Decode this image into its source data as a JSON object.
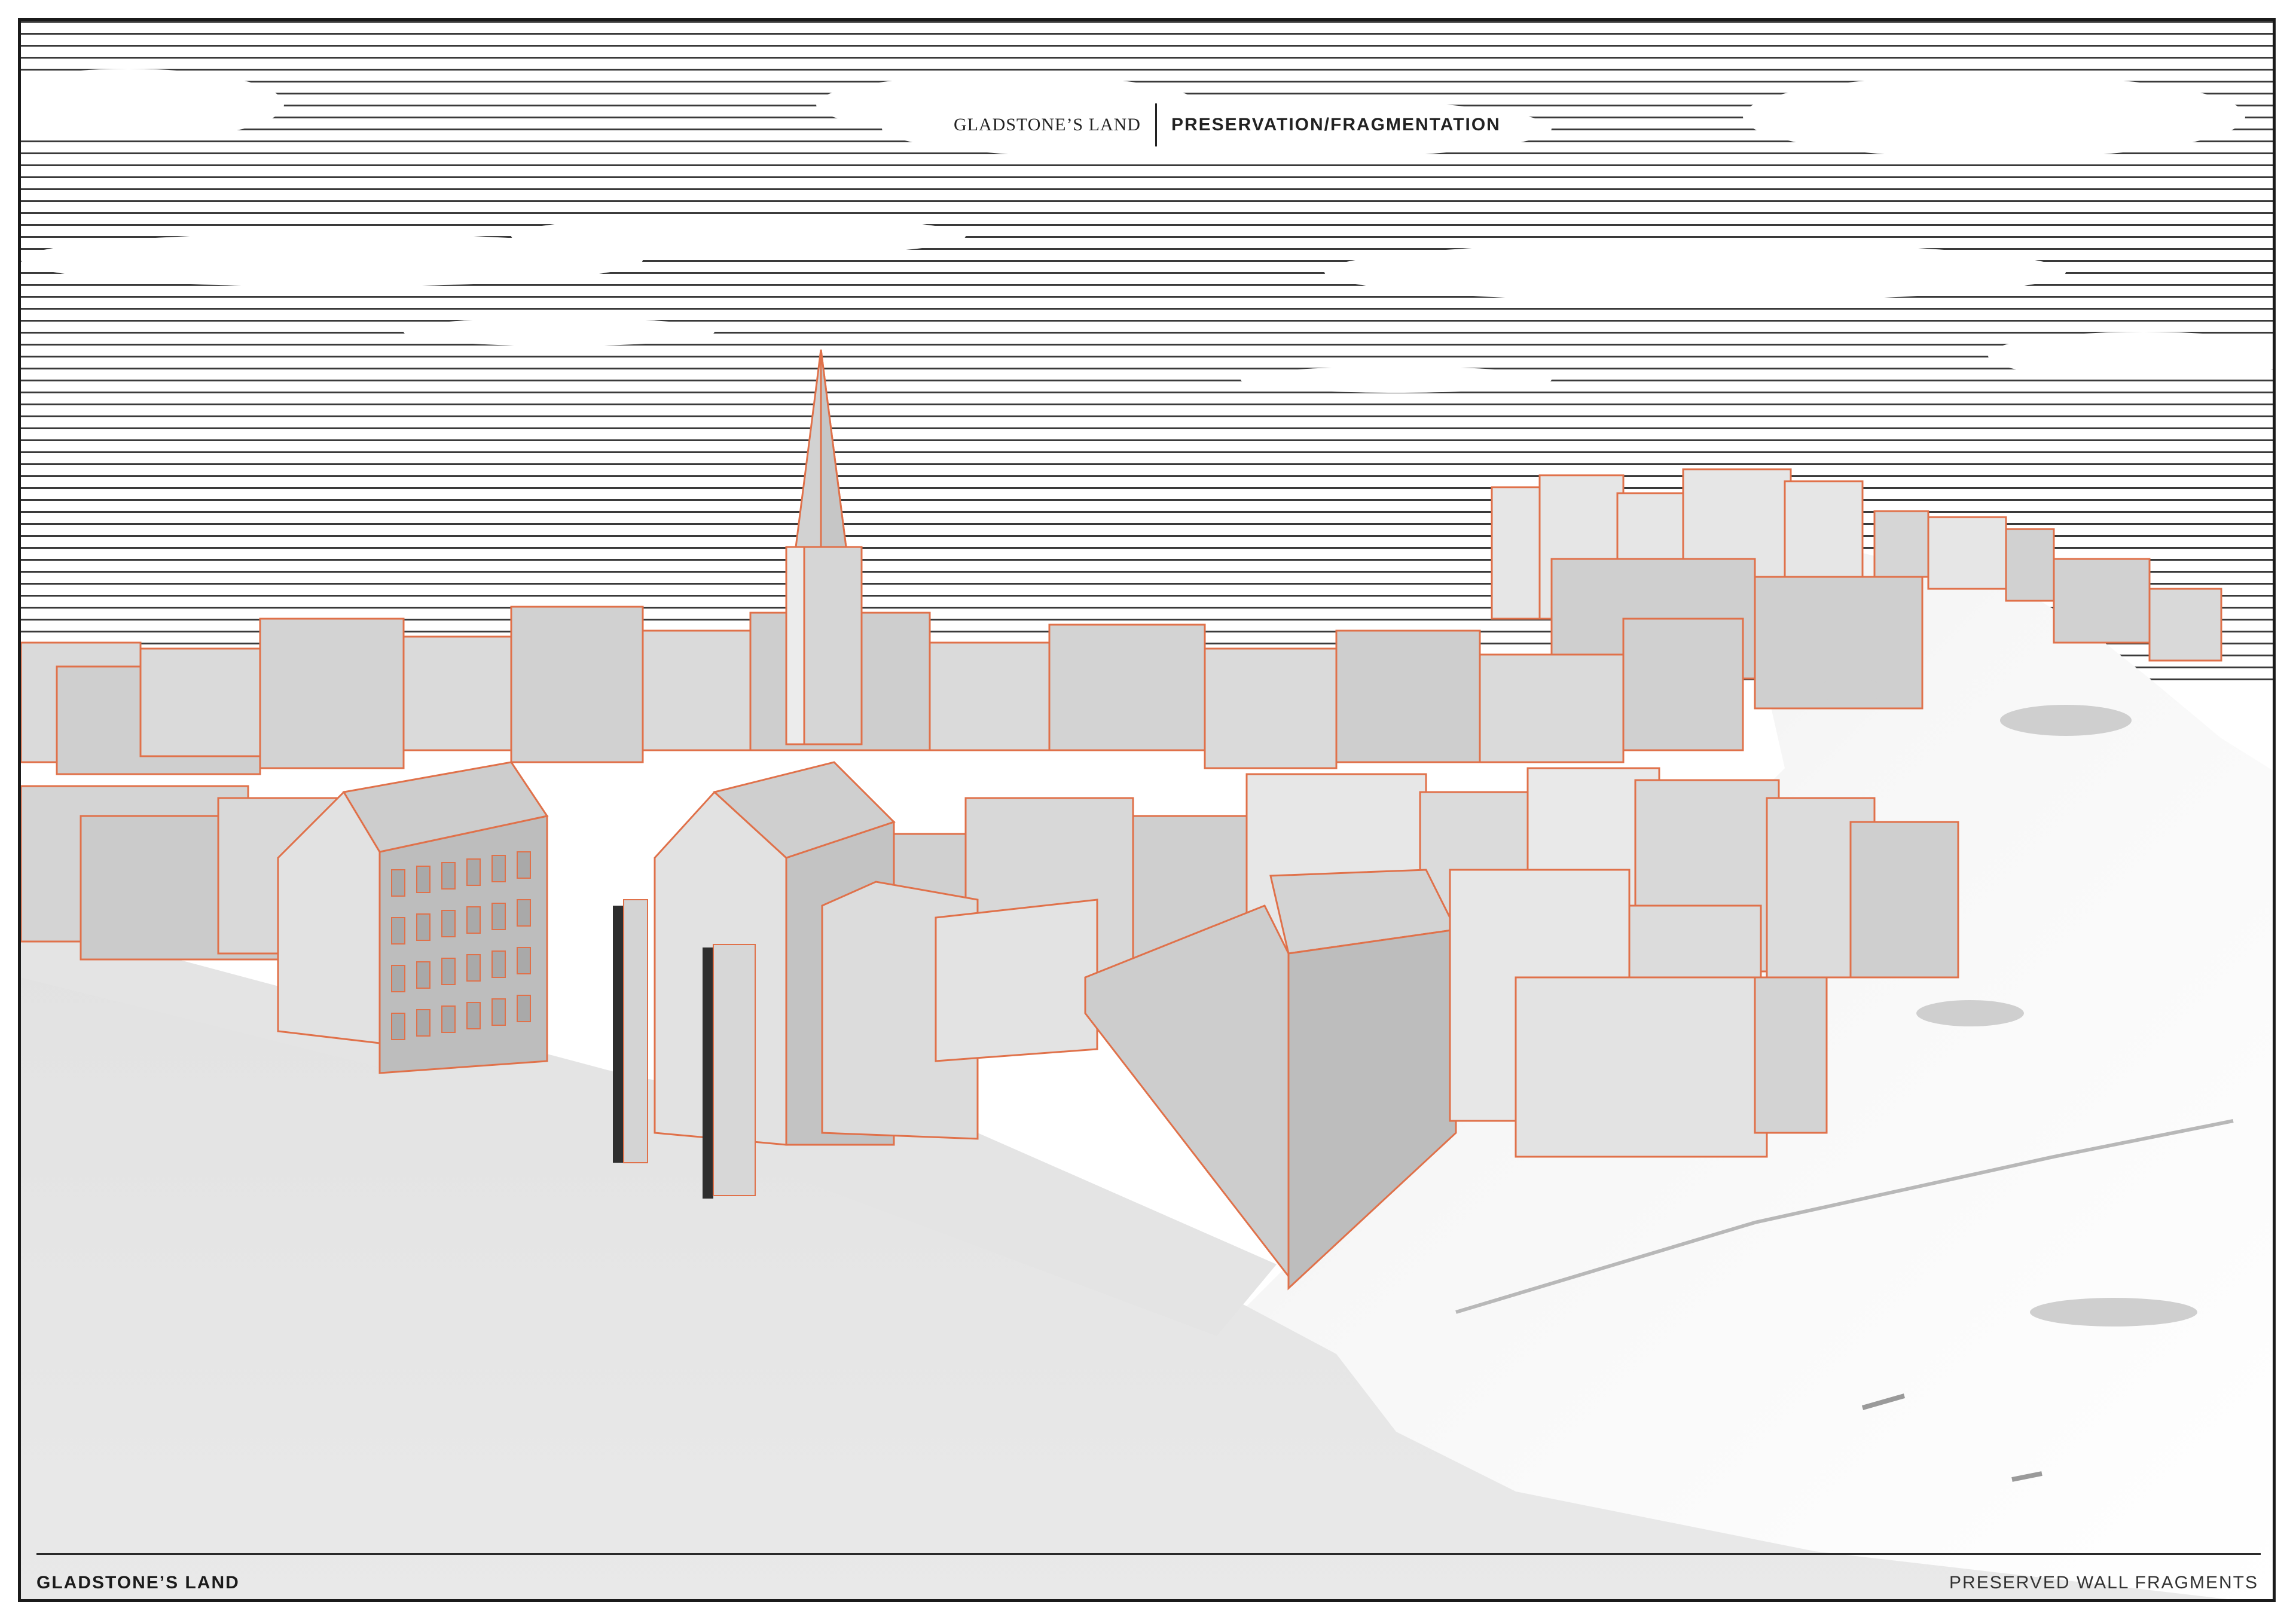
{
  "header": {
    "left_title": "GLADSTONE’S LAND",
    "right_title": "PRESERVATION/FRAGMENTATION"
  },
  "footer": {
    "left_label": "GLADSTONE’S LAND",
    "right_label": "PRESERVED WALL FRAGMENTS"
  },
  "colors": {
    "outline_accent": "#e0714a",
    "building_fill": "#d9d9d9",
    "building_shadow": "#c4c4c4",
    "preserved_wall": "#2e2e2e",
    "sky_hatch": "#3a3a3a",
    "ground": "#e6e6e6",
    "hill": "#f4f4f4"
  }
}
